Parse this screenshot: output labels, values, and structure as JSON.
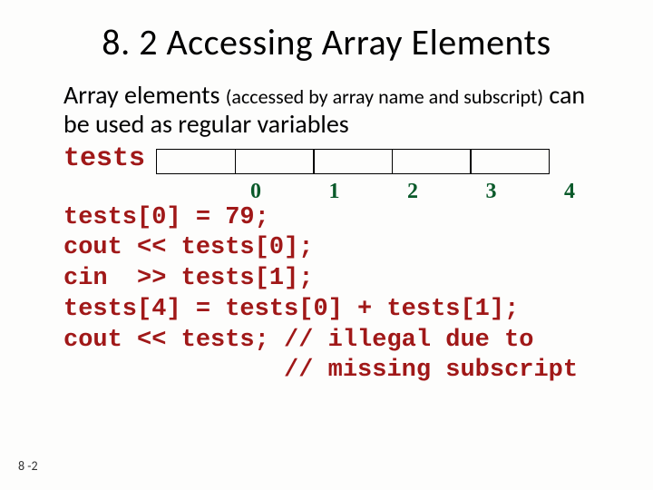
{
  "title": "8. 2 Accessing Array Elements",
  "bodytext": {
    "part1": "Array elements ",
    "part2": "(accessed by array name and subscript)",
    "part3": " can be used as regular variables"
  },
  "arrayName": "tests",
  "indices": [
    "0",
    "1",
    "2",
    "3",
    "4"
  ],
  "code": "tests[0] = 79;\ncout << tests[0];\ncin  >> tests[1];\ntests[4] = tests[0] + tests[1];\ncout << tests; // illegal due to\n               // missing subscript",
  "pageNumber": "8 -2"
}
